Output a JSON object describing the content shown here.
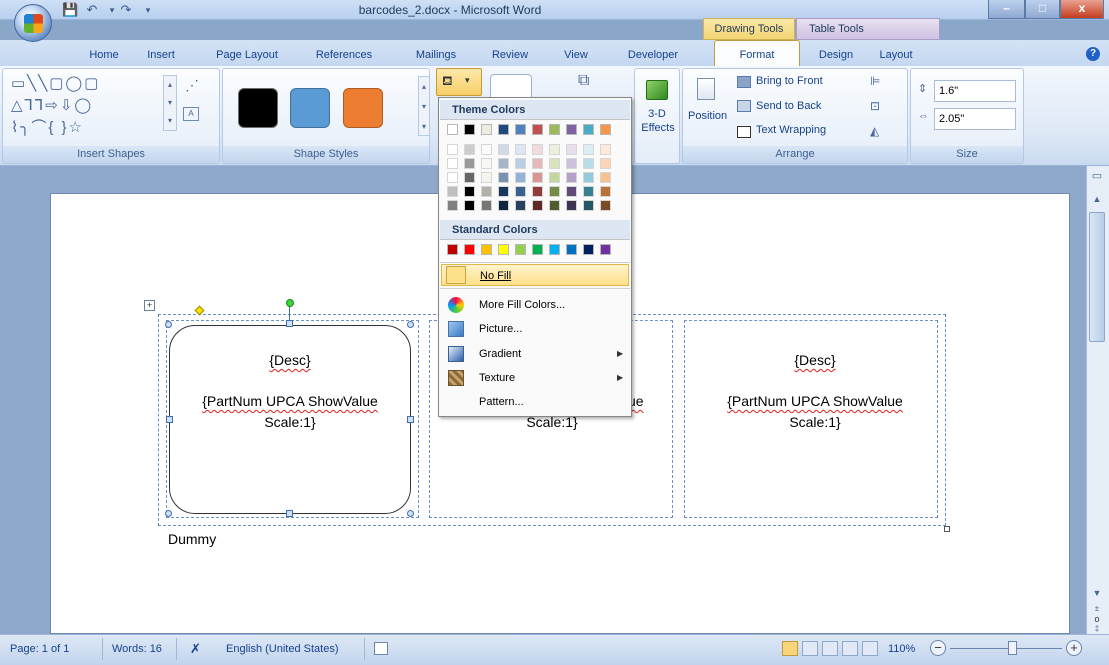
{
  "window": {
    "title": "barcodes_2.docx - Microsoft Word",
    "buttons": {
      "minimize": "–",
      "maximize": "□",
      "close": "x"
    }
  },
  "contextual_tabs": {
    "drawing": "Drawing Tools",
    "table": "Table Tools"
  },
  "tabs": [
    "Home",
    "Insert",
    "Page Layout",
    "References",
    "Mailings",
    "Review",
    "View",
    "Developer",
    "Format",
    "Design",
    "Layout"
  ],
  "active_tab": "Format",
  "ribbon": {
    "insert_shapes": {
      "label": "Insert Shapes"
    },
    "shape_styles": {
      "label": "Shape Styles",
      "colors": [
        "#000000",
        "#5b9bd5",
        "#ed7d31"
      ]
    },
    "effects_3d": {
      "label": "3-D",
      "label2": "Effects"
    },
    "arrange": {
      "label": "Arrange",
      "position": "Position",
      "bring_to_front": "Bring to Front",
      "send_to_back": "Send to Back",
      "text_wrapping": "Text Wrapping"
    },
    "size": {
      "label": "Size",
      "height": "1.6\"",
      "width": "2.05\""
    }
  },
  "dropdown": {
    "theme_header": "Theme Colors",
    "standard_header": "Standard Colors",
    "theme_colors": [
      "#ffffff",
      "#000000",
      "#eeece1",
      "#1f497d",
      "#4f81bd",
      "#c0504d",
      "#9bbb59",
      "#8064a2",
      "#4bacc6",
      "#f79646"
    ],
    "standard_colors": [
      "#c00000",
      "#ff0000",
      "#ffc000",
      "#ffff00",
      "#92d050",
      "#00b050",
      "#00b0f0",
      "#0070c0",
      "#002060",
      "#7030a0"
    ],
    "no_fill": "No Fill",
    "items": [
      "More Fill Colors...",
      "Picture...",
      "Gradient",
      "Texture",
      "Pattern..."
    ]
  },
  "document": {
    "cells": [
      {
        "desc": "{Desc}",
        "line1": "{PartNum UPCA ShowValue",
        "line2": "Scale:1}"
      },
      {
        "desc": "",
        "line1": "ue",
        "line2": "Scale:1}"
      },
      {
        "desc": "{Desc}",
        "line1": "{PartNum UPCA ShowValue",
        "line2": "Scale:1}"
      }
    ],
    "dummy": "Dummy"
  },
  "status": {
    "page": "Page: 1 of 1",
    "words": "Words: 16",
    "language": "English (United States)",
    "zoom": "110%"
  }
}
